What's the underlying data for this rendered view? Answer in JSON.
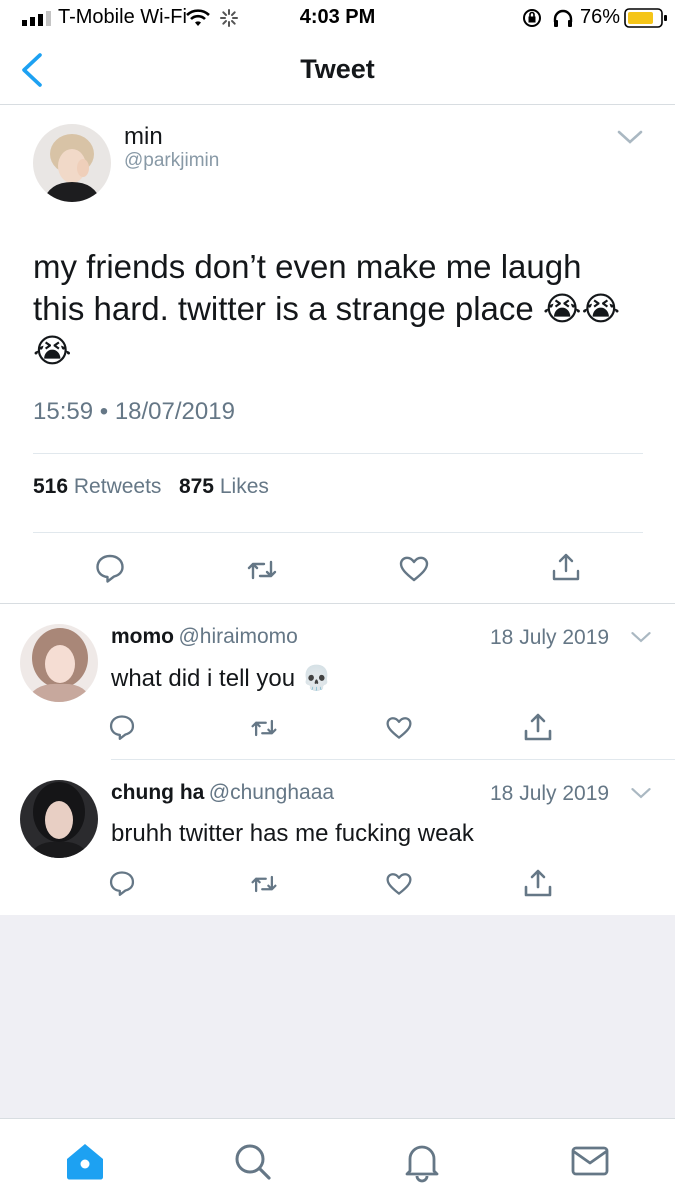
{
  "status_bar": {
    "carrier": "T-Mobile Wi-Fi",
    "time": "4:03 PM",
    "battery": "76%"
  },
  "nav": {
    "title": "Tweet"
  },
  "tweet": {
    "name": "min",
    "handle": "@parkjimin",
    "text_line1": "my friends don’t even make me laugh",
    "text_line2": "this hard. twitter is a strange place 😭😭",
    "text_line3": "😭",
    "time": "15:59",
    "separator": "•",
    "date": "18/07/2019",
    "retweets_count": "516",
    "retweets_label": "Retweets",
    "likes_count": "875",
    "likes_label": "Likes"
  },
  "replies": [
    {
      "name": "momo",
      "handle": "@hiraimomo",
      "date": "18 July 2019",
      "text": "what did i tell you 💀"
    },
    {
      "name": "chung ha",
      "handle": "@chunghaaa",
      "date": "18 July 2019",
      "text": "bruhh twitter has me fucking weak"
    }
  ],
  "colors": {
    "accent": "#1da1f2",
    "text": "#14171a",
    "secondary": "#657786",
    "divider": "#e1e8ed",
    "background_grey": "#efeff4",
    "battery": "#f5c518"
  },
  "icons": {
    "back": "chevron-left-icon",
    "reply": "reply-icon",
    "retweet": "retweet-icon",
    "like": "heart-icon",
    "share": "share-icon",
    "home": "home-icon",
    "search": "search-icon",
    "notifications": "bell-icon",
    "messages": "mail-icon"
  }
}
